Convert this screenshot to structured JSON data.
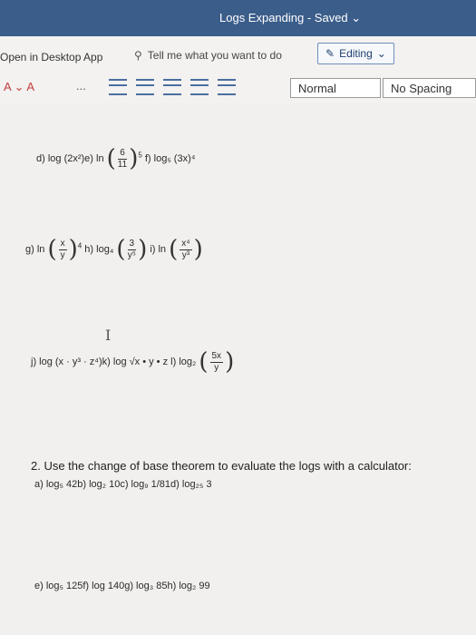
{
  "titlebar": {
    "title": "Logs Expanding - Saved ⌄"
  },
  "menubar": {
    "open_app": "Open in Desktop App",
    "tell_me": "Tell me what you want to do",
    "editing": "Editing"
  },
  "ribbon": {
    "font_color": "A ⌄  A",
    "more": "...",
    "style_normal": "Normal",
    "style_nospacing": "No Spacing"
  },
  "document": {
    "row1": {
      "d": "d) log (2x²)e) ln",
      "frac_num": "6",
      "frac_den": "11",
      "exp": "5",
      "f": "f) log₅ (3x)⁴"
    },
    "row2": {
      "g": "g) ln",
      "g_num": "x",
      "g_den": "y",
      "g_exp": "4",
      "h": "h) log₄",
      "h_num": "3",
      "h_den": "y⁵",
      "i": "i) ln",
      "i_num": "x⁴",
      "i_den": "y³"
    },
    "row3": {
      "j": "j) log (x · y³ · z⁴)k) log √x • y • z",
      "l": "l) log₂",
      "l_num": "5x",
      "l_den": "y"
    },
    "q2": "2. Use the change of base theorem to evaluate the logs with a calculator:",
    "q2a": "a) log₅ 42b) log₂ 10c) log₉ 1/81d) log₂₅ 3",
    "q2e": "e) log₅ 125f) log 140g) log₃ 85h) log₂ 99"
  }
}
